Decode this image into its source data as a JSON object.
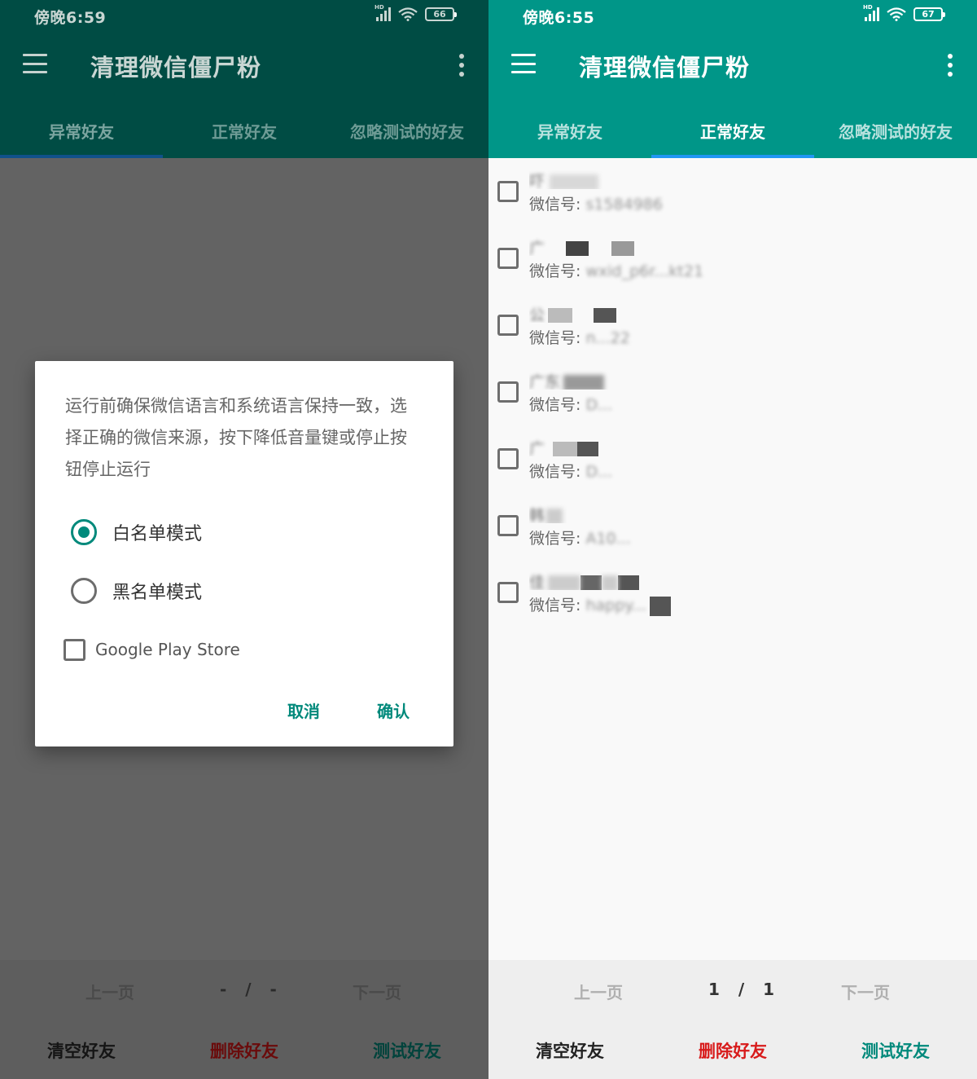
{
  "left": {
    "status_time": "傍晚6:59",
    "battery": "66",
    "app_title": "清理微信僵尸粉",
    "tabs": [
      "异常好友",
      "正常好友",
      "忽略测试的好友"
    ],
    "pager": {
      "prev": "上一页",
      "count": "- / -",
      "next": "下一页"
    },
    "actions": {
      "clear": "清空好友",
      "delete": "删除好友",
      "test": "测试好友"
    },
    "dialog": {
      "message": "运行前确保微信语言和系统语言保持一致，选择正确的微信来源，按下降低音量键或停止按钮停止运行",
      "options": [
        "白名单模式",
        "黑名单模式"
      ],
      "selected_option": "白名单模式",
      "checkbox_label": "Google Play Store",
      "cancel": "取消",
      "confirm": "确认"
    }
  },
  "right": {
    "status_time": "傍晚6:55",
    "battery": "67",
    "app_title": "清理微信僵尸粉",
    "tabs": [
      "异常好友",
      "正常好友",
      "忽略测试的好友"
    ],
    "active_tab": "正常好友",
    "id_label": "微信号:",
    "friends": [
      {
        "name": "吓",
        "id": "s1584986"
      },
      {
        "name": "广",
        "id": "wxid_p6r...kt21"
      },
      {
        "name": "公",
        "id": "n...22"
      },
      {
        "name": "广东",
        "id": "D..."
      },
      {
        "name": "广",
        "id": "D..."
      },
      {
        "name": "韩",
        "id": "A10..."
      },
      {
        "name": "佳",
        "id": "happy..."
      }
    ],
    "pager": {
      "prev": "上一页",
      "count": "1 / 1",
      "next": "下一页"
    },
    "actions": {
      "clear": "清空好友",
      "delete": "删除好友",
      "test": "测试好友"
    }
  },
  "colors": {
    "primary": "#009688",
    "accent": "#2196f3",
    "danger": "#d81b1b",
    "positive": "#00897b"
  }
}
